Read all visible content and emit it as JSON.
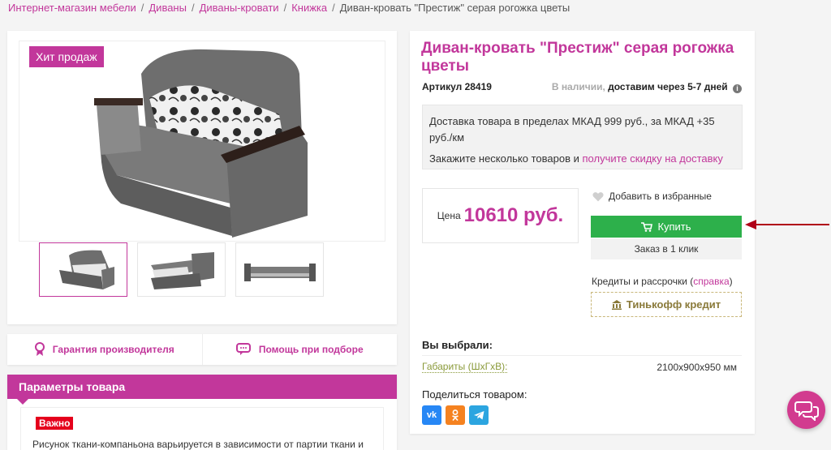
{
  "breadcrumb": {
    "items": [
      "Интернет-магазин мебели",
      "Диваны",
      "Диваны-кровати",
      "Книжка"
    ],
    "current": "Диван-кровать \"Престиж\" серая рогожка цветы",
    "separator": "/"
  },
  "gallery": {
    "badge": "Хит продаж",
    "thumbnail_count": 3,
    "active_thumbnail": 0
  },
  "features": {
    "guarantee": "Гарантия производителя",
    "help": "Помощь при подборе"
  },
  "params": {
    "title": "Параметры товара",
    "important_label": "Важно",
    "text": "Рисунок ткани-компаньона варьируется в зависимости от партии ткани и"
  },
  "product": {
    "title": "Диван-кровать \"Престиж\" серая рогожка цветы",
    "sku": "Артикул 28419",
    "stock_status": "В наличии,",
    "delivery_time": "доставим через 5-7 дней",
    "delivery_line1": "Доставка товара в пределах МКАД 999 руб., за МКАД +35 руб./км",
    "delivery_line2_text": "Закажите несколько товаров и",
    "delivery_line2_link": "получите скидку на доставку",
    "price_label": "Цена",
    "price_value": "10610 руб.",
    "favorite_label": "Добавить в избранные",
    "buy_label": "Купить",
    "oneclick_label": "Заказ в 1 клик",
    "credit_text": "Кредиты и рассрочки (",
    "credit_link": "справка",
    "credit_close": ")",
    "tinkoff_label": "Тинькофф кредит",
    "chosen_title": "Вы выбрали:",
    "chosen_key": "Габариты (ШхГхВ):",
    "chosen_value": "2100x900x950 мм",
    "share_title": "Поделиться товаром:"
  },
  "colors": {
    "accent": "#c2379b",
    "buy": "#2db04b",
    "important": "#e5001c",
    "arrow": "#b00018"
  }
}
